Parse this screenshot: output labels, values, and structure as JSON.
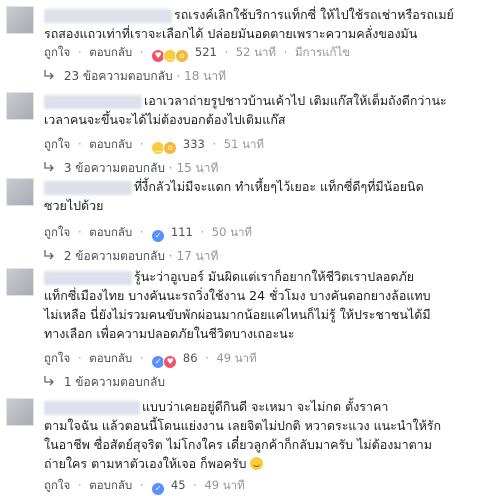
{
  "actions": {
    "like": "ถูกใจ",
    "reply": "ตอบกลับ",
    "edited": "มีการแก้ไข",
    "dot": "·"
  },
  "comments": [
    {
      "lines": [
        "รถเรงค์เลิกใช้บริการแท็กซี่  ให้ไปใช้รถเช่าหรือรถเมย์",
        "รถสองแถวเท่าที่เราจะเลือกได้  ปล่อยมันอดตายเพราะความคลั่งของมัน"
      ],
      "reactions": [
        "love-icon",
        "haha-icon",
        "wow-icon"
      ],
      "reaction_count": "521",
      "time": "52 นาที",
      "edited": true,
      "replies": "23 ข้อความตอบกลับ",
      "replies_time": "18 นาที"
    },
    {
      "lines": [
        "เอาเวลาถ่ายรูปชาวบ้านเค้าไป  เติมแก๊สให้เต็มถังดีกว่านะ",
        "เวลาคนจะขึ้นจะได้ไม่ต้องบอกต้องไปเติมแก๊ส"
      ],
      "reactions": [
        "haha-icon",
        "wow-icon"
      ],
      "reaction_count": "333",
      "time": "51 นาที",
      "edited": false,
      "replies": "3 ข้อความตอบกลับ",
      "replies_time": "15 นาที"
    },
    {
      "lines": [
        "ที่งี้กลัวไม่มีจะแดก  ทำเหี้ยๆไว้เยอะ  แท็กซี่ดีๆที่มีน้อยนิด",
        "ซวยไปด้วย"
      ],
      "reactions": [
        "like-icon"
      ],
      "reaction_count": "111",
      "time": "50 นาที",
      "edited": false,
      "replies": "2 ข้อความตอบกลับ",
      "replies_time": "17 นาที"
    },
    {
      "lines": [
        "รู้นะว่าอูเบอร์  มันผิดแต่เราก็อยากให้ชีวิตเราปลอดภัย",
        "แท็กซี่เมืองไทย  บางคันนะรถวิ่งใช้งาน 24 ชั่วโมง  บางคันดอกยางล้อแทบ",
        "ไม่เหลือ  นี่ยังไม่รวมคนขับพักผ่อนมากน้อยแค่ไหนก็ไม่รู้  ให้ประชาชนได้มี",
        "ทางเลือก  เพื่อความปลอดภัยในชีวิตบางเถอะนะ"
      ],
      "reactions": [
        "like-icon",
        "love-icon"
      ],
      "reaction_count": "86",
      "time": "49 นาที",
      "edited": false,
      "replies": "1 ข้อความตอบกลับ",
      "replies_time": ""
    },
    {
      "lines": [
        "แบบว่าเคยอยู่ดีกินดี  จะเหมา  จะไม่กด  ตั้งราคา",
        "ตามใจฉัน  แล้วตอนนี้โดนแย่งงาน  เลยจิตไม่ปกติ  หวาดระแวง  แนะนำให้รัก",
        "ในอาชีพ  ซื่อสัตย์สุจริต  ไม่โกงใคร  เดี๋ยวลูกค้าก็กลับมาครับ  ไม่ต้องมาตาม",
        "ถ่ายใคร  ตามหาตัวเองให้เจอ  ก็พอครับ"
      ],
      "reactions": [
        "like-icon"
      ],
      "reaction_count": "45",
      "time": "49 นาที",
      "edited": false,
      "replies": "",
      "replies_time": ""
    }
  ]
}
